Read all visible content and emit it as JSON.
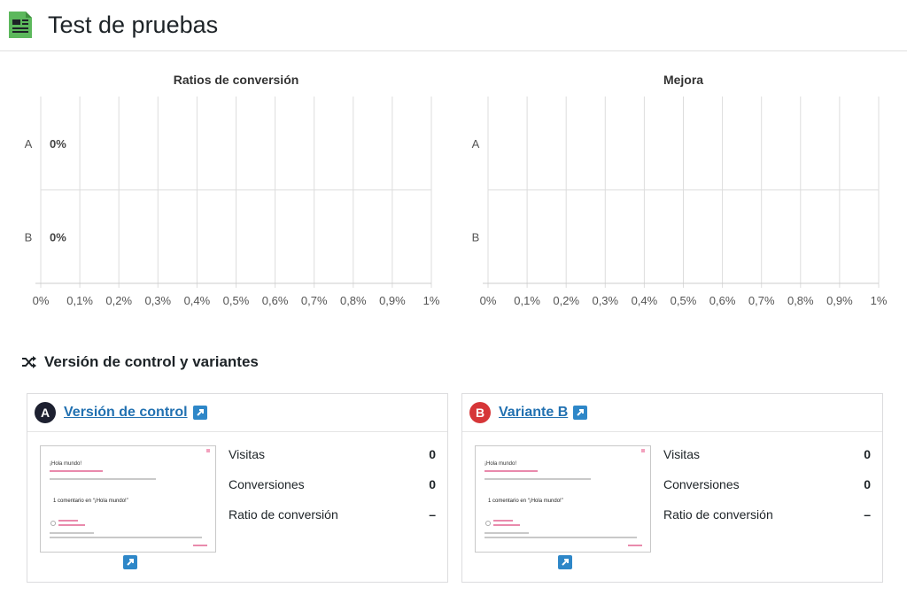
{
  "header": {
    "title": "Test de pruebas",
    "icon": "document-icon",
    "icon_color": "#5cb85c"
  },
  "charts": [
    {
      "id": "conversion",
      "title": "Ratios de conversión",
      "type": "bar",
      "orientation": "horizontal",
      "categories": [
        "A",
        "B"
      ],
      "values": [
        0,
        0
      ],
      "value_labels": [
        "0%",
        "0%"
      ],
      "xlim": [
        0,
        1
      ],
      "x_ticks": [
        "0%",
        "0,1%",
        "0,2%",
        "0,3%",
        "0,4%",
        "0,5%",
        "0,6%",
        "0,7%",
        "0,8%",
        "0,9%",
        "1%"
      ],
      "grid": true
    },
    {
      "id": "improvement",
      "title": "Mejora",
      "type": "bar",
      "orientation": "horizontal",
      "categories": [
        "A",
        "B"
      ],
      "values": [
        0,
        0
      ],
      "value_labels": [
        "",
        ""
      ],
      "xlim": [
        0,
        1
      ],
      "x_ticks": [
        "0%",
        "0,1%",
        "0,2%",
        "0,3%",
        "0,4%",
        "0,5%",
        "0,6%",
        "0,7%",
        "0,8%",
        "0,9%",
        "1%"
      ],
      "grid": true
    }
  ],
  "section": {
    "title": "Versión de control y variantes",
    "icon": "shuffle-icon"
  },
  "variants": [
    {
      "badge": "A",
      "badge_color": "#1d2030",
      "name": "Versión de control",
      "thumbnail": {
        "post_title": "¡Hola mundo!",
        "comments_title": "1 comentario en “¡Hola mundo!”"
      },
      "stats": [
        {
          "label": "Visitas",
          "value": "0"
        },
        {
          "label": "Conversiones",
          "value": "0"
        },
        {
          "label": "Ratio de conversión",
          "value": "–"
        }
      ]
    },
    {
      "badge": "B",
      "badge_color": "#d63638",
      "name": "Variante B",
      "thumbnail": {
        "post_title": "¡Hola mundo!",
        "comments_title": "1 comentario en “¡Hola mundo!”"
      },
      "stats": [
        {
          "label": "Visitas",
          "value": "0"
        },
        {
          "label": "Conversiones",
          "value": "0"
        },
        {
          "label": "Ratio de conversión",
          "value": "–"
        }
      ]
    }
  ],
  "colors": {
    "link": "#2271b1",
    "external_button": "#2e87c8",
    "grid": "#dddddd"
  }
}
